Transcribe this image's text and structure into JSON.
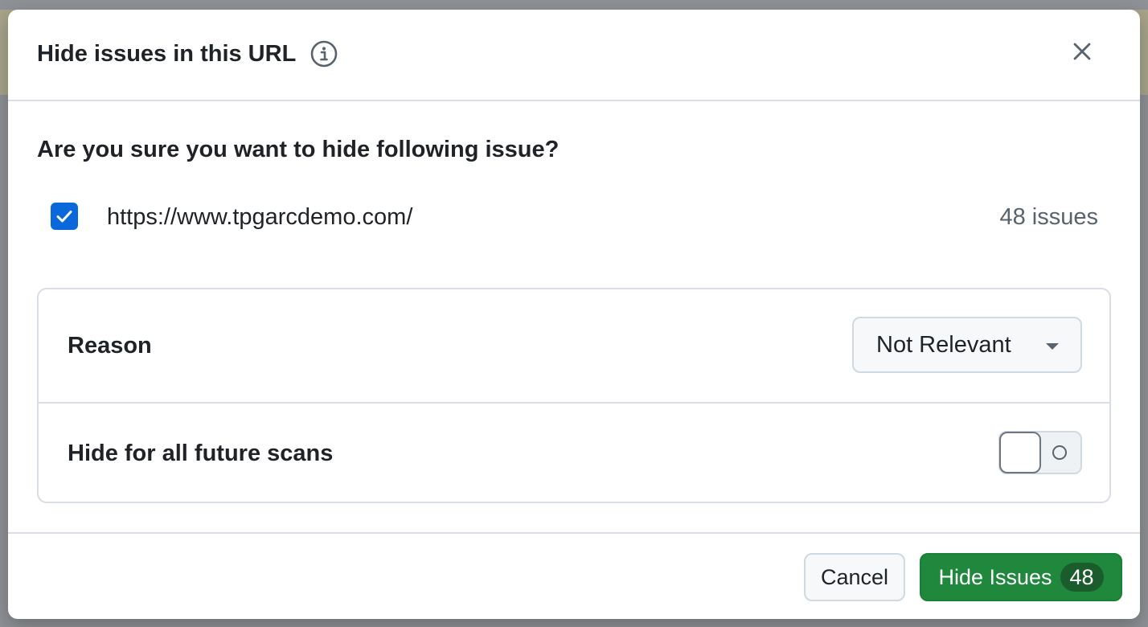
{
  "dialog": {
    "title": "Hide issues in this URL",
    "close_icon": "close-icon",
    "info_icon": "info-icon"
  },
  "question": "Are you sure you want to hide following issue?",
  "target": {
    "checked": true,
    "url": "https://www.tpgarcdemo.com/",
    "count_label": "48 issues"
  },
  "options": {
    "reason": {
      "label": "Reason",
      "selected": "Not Relevant",
      "caret_icon": "triangle-down-icon"
    },
    "future_scans": {
      "label": "Hide for all future scans",
      "enabled": false
    }
  },
  "footer": {
    "cancel_label": "Cancel",
    "primary_label": "Hide Issues",
    "primary_count": "48"
  },
  "colors": {
    "accent_blue": "#0969da",
    "primary_green": "#1f883d",
    "muted_text": "#59636e",
    "border": "#d8dee4"
  }
}
